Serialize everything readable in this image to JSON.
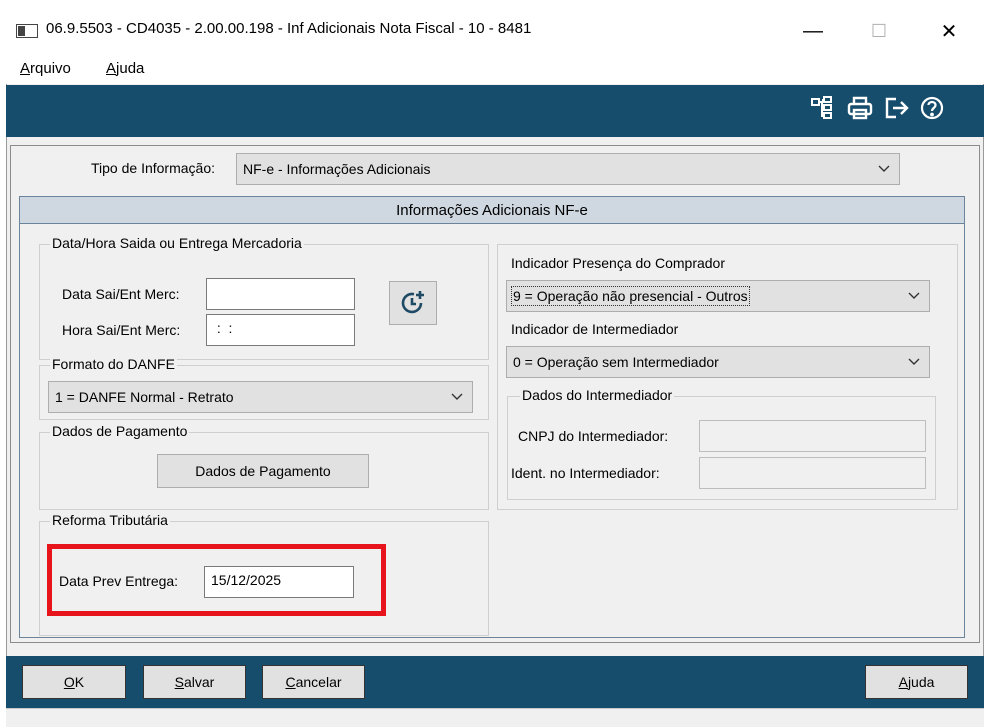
{
  "window": {
    "title": "06.9.5503 - CD4035 - 2.00.00.198 - Inf Adicionais Nota Fiscal - 10 - 8481",
    "minimize_glyph": "—",
    "maximize_glyph": "☐",
    "close_glyph": "✕"
  },
  "menu": [
    "Arquivo",
    "Ajuda"
  ],
  "toolbar": {
    "icons": [
      "tree-structure-icon",
      "printer-icon",
      "exit-icon",
      "help-icon"
    ],
    "color": "#174d6c"
  },
  "tipo_informacao": {
    "label": "Tipo de Informação:",
    "value": "NF-e - Informações Adicionais"
  },
  "panel": {
    "title": "Informações Adicionais NF-e",
    "data_hora": {
      "legend": "Data/Hora Saida ou Entrega Mercadoria",
      "data_label": "Data Sai/Ent Merc:",
      "data_value": "",
      "hora_label": "Hora Sai/Ent Merc:",
      "hora_value": " :  :"
    },
    "formato_danfe": {
      "legend": "Formato do DANFE",
      "value": "1 = DANFE Normal - Retrato"
    },
    "pagamento": {
      "legend": "Dados de Pagamento",
      "button": "Dados de Pagamento"
    },
    "reforma": {
      "legend": "Reforma Tributária",
      "data_prev_label": "Data Prev Entrega:",
      "data_prev_value": "15/12/2025",
      "highlight_color": "#e8141b"
    },
    "presenca": {
      "label": "Indicador Presença do Comprador",
      "value": "9 = Operação não presencial - Outros"
    },
    "intermediador": {
      "label": "Indicador de Intermediador",
      "value": "0 = Operação sem Intermediador"
    },
    "dados_intermediador": {
      "legend": "Dados do Intermediador",
      "cnpj_label": "CNPJ do Intermediador:",
      "cnpj_value": "",
      "ident_label": "Ident. no Intermediador:",
      "ident_value": ""
    }
  },
  "buttons": {
    "ok": "OK",
    "salvar": "Salvar",
    "cancelar": "Cancelar",
    "ajuda": "Ajuda"
  }
}
